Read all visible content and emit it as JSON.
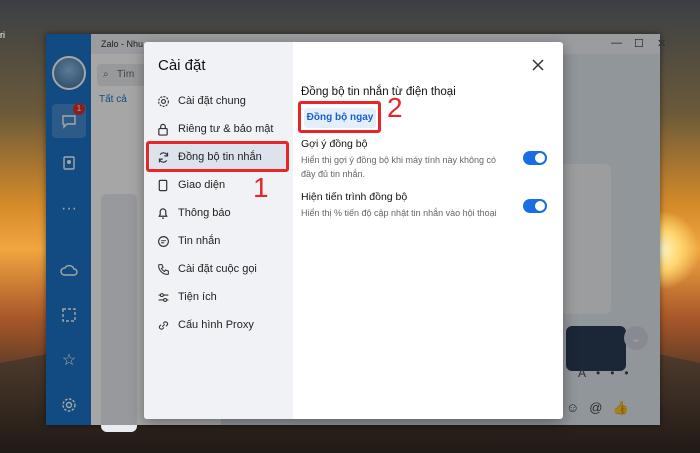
{
  "desktop": {
    "corner_text": "ri"
  },
  "window": {
    "title": "Zalo - Nhu",
    "badge_count": "1",
    "search_placeholder": "Tìm",
    "tab_all": "Tất cả"
  },
  "dialog": {
    "title": "Cài đặt",
    "nav": [
      {
        "label": "Cài đặt chung",
        "icon": "gear-icon"
      },
      {
        "label": "Riêng tư & bảo mật",
        "icon": "lock-icon"
      },
      {
        "label": "Đồng bộ tin nhắn",
        "icon": "sync-icon"
      },
      {
        "label": "Giao diện",
        "icon": "palette-icon"
      },
      {
        "label": "Thông báo",
        "icon": "bell-icon"
      },
      {
        "label": "Tin nhắn",
        "icon": "message-icon"
      },
      {
        "label": "Cài đặt cuộc gọi",
        "icon": "phone-icon"
      },
      {
        "label": "Tiện ích",
        "icon": "sliders-icon"
      },
      {
        "label": "Cấu hình Proxy",
        "icon": "proxy-icon"
      }
    ],
    "selected_index": 2,
    "section_title": "Đồng bộ tin nhắn từ điện thoại",
    "sync_button": "Đồng bộ ngay",
    "options": [
      {
        "title": "Gợi ý đồng bộ",
        "desc": "Hiển thị gợi ý đồng bộ khi máy tính này không có đầy đủ tin nhắn.",
        "enabled": true
      },
      {
        "title": "Hiện tiến trình đồng bộ",
        "desc": "Hiển thị % tiến độ cập nhật tin nhắn vào hội thoại",
        "enabled": true
      }
    ]
  },
  "annotations": {
    "marker_1": "1",
    "marker_2": "2"
  },
  "colors": {
    "accent": "#1a6ee0",
    "highlight": "#e8262a",
    "sidebar": "#1b73c8"
  }
}
